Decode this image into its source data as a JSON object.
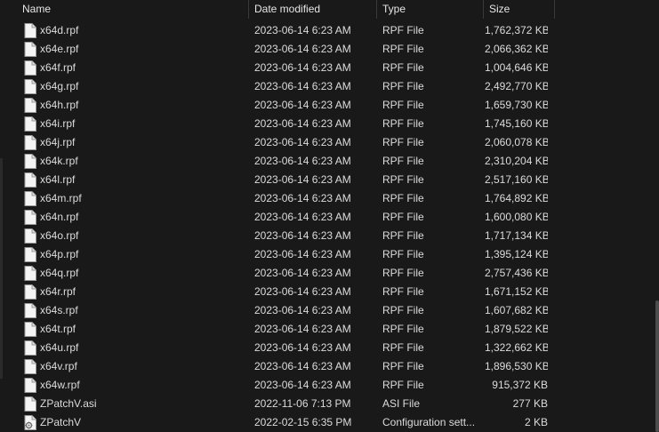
{
  "columns": {
    "name": "Name",
    "date": "Date modified",
    "type": "Type",
    "size": "Size"
  },
  "files": [
    {
      "name": "x64d.rpf",
      "date": "2023-06-14 6:23 AM",
      "type": "RPF File",
      "size": "1,762,372 KB",
      "icon": "file-icon"
    },
    {
      "name": "x64e.rpf",
      "date": "2023-06-14 6:23 AM",
      "type": "RPF File",
      "size": "2,066,362 KB",
      "icon": "file-icon"
    },
    {
      "name": "x64f.rpf",
      "date": "2023-06-14 6:23 AM",
      "type": "RPF File",
      "size": "1,004,646 KB",
      "icon": "file-icon"
    },
    {
      "name": "x64g.rpf",
      "date": "2023-06-14 6:23 AM",
      "type": "RPF File",
      "size": "2,492,770 KB",
      "icon": "file-icon"
    },
    {
      "name": "x64h.rpf",
      "date": "2023-06-14 6:23 AM",
      "type": "RPF File",
      "size": "1,659,730 KB",
      "icon": "file-icon"
    },
    {
      "name": "x64i.rpf",
      "date": "2023-06-14 6:23 AM",
      "type": "RPF File",
      "size": "1,745,160 KB",
      "icon": "file-icon"
    },
    {
      "name": "x64j.rpf",
      "date": "2023-06-14 6:23 AM",
      "type": "RPF File",
      "size": "2,060,078 KB",
      "icon": "file-icon"
    },
    {
      "name": "x64k.rpf",
      "date": "2023-06-14 6:23 AM",
      "type": "RPF File",
      "size": "2,310,204 KB",
      "icon": "file-icon"
    },
    {
      "name": "x64l.rpf",
      "date": "2023-06-14 6:23 AM",
      "type": "RPF File",
      "size": "2,517,160 KB",
      "icon": "file-icon"
    },
    {
      "name": "x64m.rpf",
      "date": "2023-06-14 6:23 AM",
      "type": "RPF File",
      "size": "1,764,892 KB",
      "icon": "file-icon"
    },
    {
      "name": "x64n.rpf",
      "date": "2023-06-14 6:23 AM",
      "type": "RPF File",
      "size": "1,600,080 KB",
      "icon": "file-icon"
    },
    {
      "name": "x64o.rpf",
      "date": "2023-06-14 6:23 AM",
      "type": "RPF File",
      "size": "1,717,134 KB",
      "icon": "file-icon"
    },
    {
      "name": "x64p.rpf",
      "date": "2023-06-14 6:23 AM",
      "type": "RPF File",
      "size": "1,395,124 KB",
      "icon": "file-icon"
    },
    {
      "name": "x64q.rpf",
      "date": "2023-06-14 6:23 AM",
      "type": "RPF File",
      "size": "2,757,436 KB",
      "icon": "file-icon"
    },
    {
      "name": "x64r.rpf",
      "date": "2023-06-14 6:23 AM",
      "type": "RPF File",
      "size": "1,671,152 KB",
      "icon": "file-icon"
    },
    {
      "name": "x64s.rpf",
      "date": "2023-06-14 6:23 AM",
      "type": "RPF File",
      "size": "1,607,682 KB",
      "icon": "file-icon"
    },
    {
      "name": "x64t.rpf",
      "date": "2023-06-14 6:23 AM",
      "type": "RPF File",
      "size": "1,879,522 KB",
      "icon": "file-icon"
    },
    {
      "name": "x64u.rpf",
      "date": "2023-06-14 6:23 AM",
      "type": "RPF File",
      "size": "1,322,662 KB",
      "icon": "file-icon"
    },
    {
      "name": "x64v.rpf",
      "date": "2023-06-14 6:23 AM",
      "type": "RPF File",
      "size": "1,896,530 KB",
      "icon": "file-icon"
    },
    {
      "name": "x64w.rpf",
      "date": "2023-06-14 6:23 AM",
      "type": "RPF File",
      "size": "915,372 KB",
      "icon": "file-icon"
    },
    {
      "name": "ZPatchV.asi",
      "date": "2022-11-06 7:13 PM",
      "type": "ASI File",
      "size": "277 KB",
      "icon": "file-icon"
    },
    {
      "name": "ZPatchV",
      "date": "2022-02-15 6:35 PM",
      "type": "Configuration sett...",
      "size": "2 KB",
      "icon": "settings-file-icon"
    }
  ]
}
